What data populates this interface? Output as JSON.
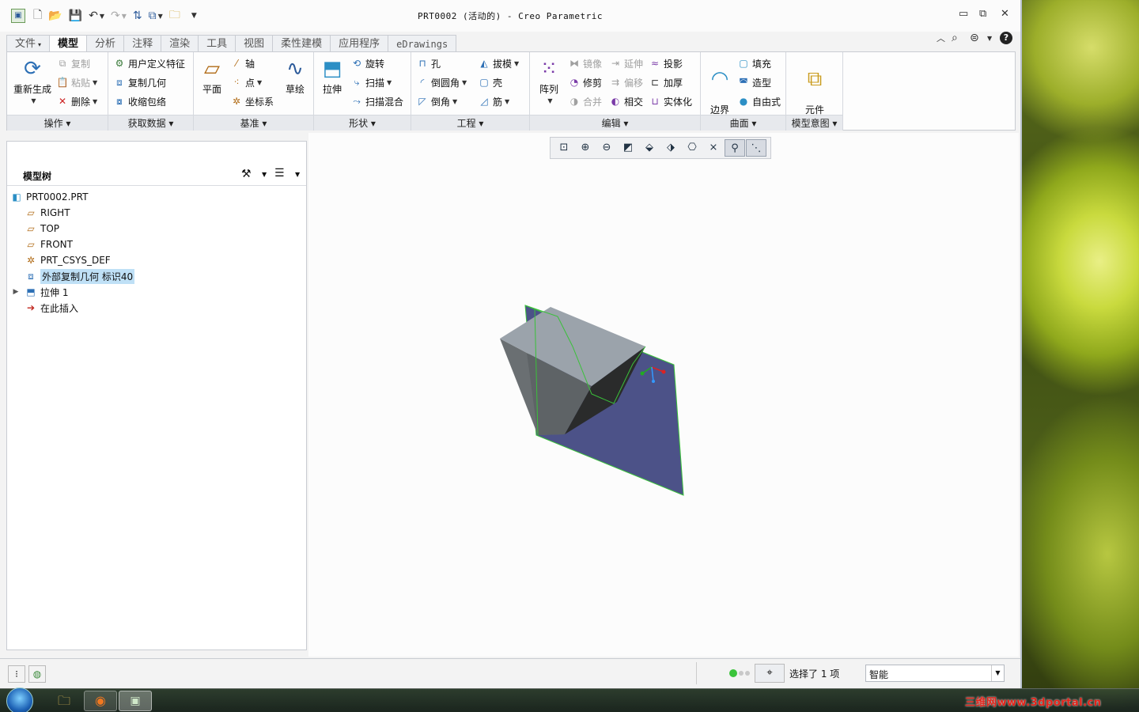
{
  "window": {
    "title": "PRT0002 (活动的) - Creo Parametric",
    "minimize_glyph": "▭",
    "maximize_glyph": "⧉",
    "close_glyph": "✕"
  },
  "quick_access": [
    "app-logo-icon",
    "new-icon",
    "open-icon",
    "save-icon",
    "undo-icon",
    "redo-icon",
    "regenerate-icon",
    "windows-icon",
    "close-window-icon",
    "customize-icon"
  ],
  "tabs": [
    {
      "label": "文件",
      "dropdown": "▾"
    },
    {
      "label": "模型",
      "active": true
    },
    {
      "label": "分析"
    },
    {
      "label": "注释"
    },
    {
      "label": "渲染"
    },
    {
      "label": "工具"
    },
    {
      "label": "视图"
    },
    {
      "label": "柔性建模"
    },
    {
      "label": "应用程序"
    },
    {
      "label": "eDrawings"
    }
  ],
  "ribbon": {
    "groups": [
      {
        "label": "操作 ▾"
      },
      {
        "label": "获取数据 ▾"
      },
      {
        "label": "基准 ▾"
      },
      {
        "label": "形状 ▾"
      },
      {
        "label": "工程 ▾"
      },
      {
        "label": "编辑 ▾"
      },
      {
        "label": "曲面 ▾"
      },
      {
        "label": "模型意图 ▾"
      }
    ],
    "ops": {
      "regenerate": "重新生成",
      "copy": "复制",
      "paste": "粘贴",
      "delete": "删除"
    },
    "getdata": {
      "udf": "用户定义特征",
      "copy_geom": "复制几何",
      "shrinkwrap": "收缩包络"
    },
    "datum": {
      "plane": "平面",
      "axis": "轴",
      "point": "点",
      "csys": "坐标系",
      "sketch": "草绘"
    },
    "shape": {
      "extrude": "拉伸",
      "revolve": "旋转",
      "sweep": "扫描",
      "swept_blend": "扫描混合"
    },
    "engineering": {
      "hole": "孔",
      "round": "倒圆角",
      "chamfer": "倒角",
      "draft": "拔模",
      "shell": "壳",
      "rib": "筋"
    },
    "edit": {
      "pattern": "阵列",
      "mirror": "镜像",
      "trim": "修剪",
      "merge": "合并",
      "extend": "延伸",
      "offset": "偏移",
      "intersect": "相交",
      "project": "投影",
      "thicken": "加厚",
      "solidify": "实体化"
    },
    "surfaces": {
      "boundary_blend": "边界\n混合",
      "fill": "填充",
      "style": "造型",
      "freestyle": "自由式"
    },
    "intent": {
      "component_interface": "元件\n界面"
    }
  },
  "model_tree": {
    "title": "模型树",
    "items": [
      {
        "label": "PRT0002.PRT",
        "icon": "part-icon",
        "level": 0
      },
      {
        "label": "RIGHT",
        "icon": "datum-plane-icon",
        "level": 1
      },
      {
        "label": "TOP",
        "icon": "datum-plane-icon",
        "level": 1
      },
      {
        "label": "FRONT",
        "icon": "datum-plane-icon",
        "level": 1
      },
      {
        "label": "PRT_CSYS_DEF",
        "icon": "csys-icon",
        "level": 1
      },
      {
        "label": "外部复制几何 标识40",
        "icon": "external-copy-geometry-icon",
        "level": 1,
        "selected": true
      },
      {
        "label": "拉伸 1",
        "icon": "extrude-feature-icon",
        "level": 1,
        "expandable": true
      },
      {
        "label": "在此插入",
        "icon": "insert-here-icon",
        "level": 1
      }
    ]
  },
  "view_toolbar": [
    "refit-icon",
    "zoom-in-icon",
    "zoom-out-icon",
    "repaint-icon",
    "display-style-icon",
    "saved-orientations-icon",
    "named-views-icon",
    "datum-display-icon",
    "spin-center-icon",
    "annotation-display-icon"
  ],
  "status": {
    "selection": "选择了 1 项",
    "filter": "智能"
  },
  "watermark": "三维网www.3dportal.cn",
  "colors": {
    "accent": "#2c5a9a",
    "selection": "#bfe0f6",
    "surface_fill": "#4c5288",
    "model_top": "#9ba3ab",
    "model_front": "#6a6f72",
    "model_dark": "#2a2b2b",
    "edge_green": "#3ac13a"
  }
}
